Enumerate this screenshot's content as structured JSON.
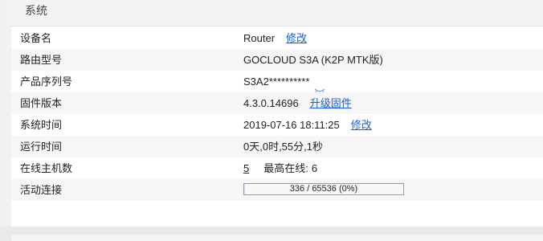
{
  "panel": {
    "title": "系统"
  },
  "rows": [
    {
      "label": "设备名",
      "value": "Router",
      "link": "修改"
    },
    {
      "label": "路由型号",
      "value": "GOCLOUD S3A (K2P MTK版)"
    },
    {
      "label": "产品序列号",
      "value": "S3A2**********",
      "icon": "eye-closed-icon"
    },
    {
      "label": "固件版本",
      "value": "4.3.0.14696",
      "link": "升级固件"
    },
    {
      "label": "系统时间",
      "value": "2019-07-16 18:11:25",
      "link": "修改"
    },
    {
      "label": "运行时间",
      "value": "0天,0时,55分,1秒"
    },
    {
      "label": "在线主机数",
      "value": "5",
      "peak_label": "最高在线:",
      "peak_value": "6"
    },
    {
      "label": "活动连接",
      "progress_text": "336 / 65536 (0%)",
      "progress_fraction": 0.005
    }
  ],
  "colors": {
    "link": "#1a5fd1",
    "progress_border": "#9a9a9a"
  }
}
